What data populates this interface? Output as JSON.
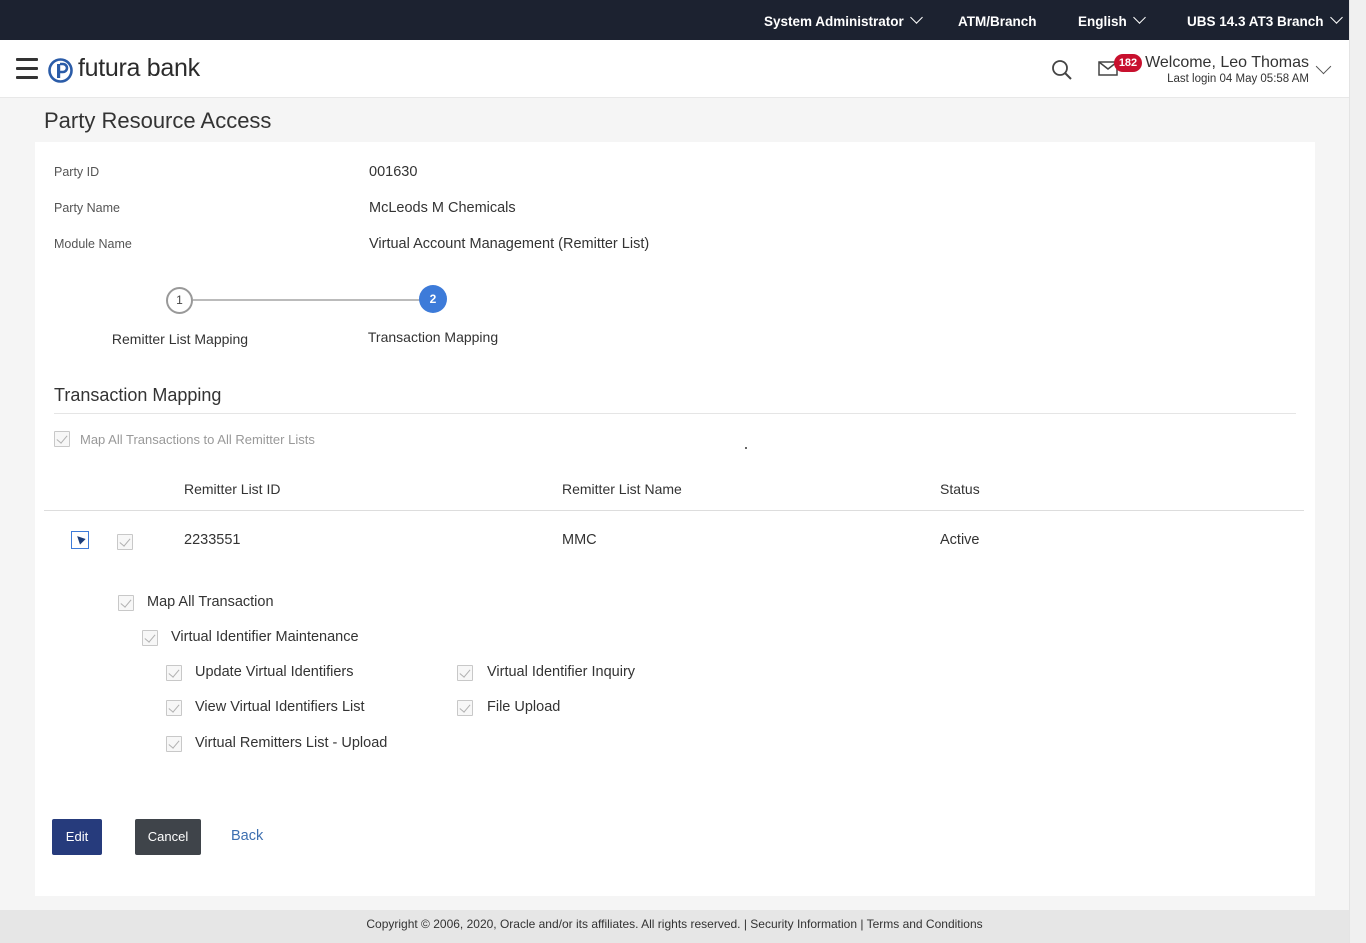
{
  "topbar": {
    "role": "System Administrator",
    "atm_branch": "ATM/Branch",
    "language": "English",
    "branch": "UBS 14.3 AT3 Branch"
  },
  "header": {
    "brand": "futura bank",
    "notification_count": "182",
    "welcome": "Welcome, Leo Thomas",
    "last_login": "Last login 04 May 05:58 AM"
  },
  "page": {
    "title": "Party Resource Access",
    "fields": [
      {
        "label": "Party ID",
        "value": "001630"
      },
      {
        "label": "Party Name",
        "value": "McLeods M Chemicals"
      },
      {
        "label": "Module Name",
        "value": "Virtual Account Management (Remitter List)"
      }
    ],
    "steps": [
      {
        "number": "1",
        "label": "Remitter List Mapping",
        "state": "completed"
      },
      {
        "number": "2",
        "label": "Transaction Mapping",
        "state": "active"
      }
    ],
    "section_title": "Transaction Mapping",
    "map_all_label": "Map All Transactions to All Remitter Lists",
    "dot": ".",
    "table": {
      "headers": [
        "Remitter List ID",
        "Remitter List Name",
        "Status"
      ],
      "rows": [
        {
          "id": "2233551",
          "name": "MMC",
          "status": "Active"
        }
      ]
    },
    "transactions": {
      "map_all": "Map All Transaction",
      "group": "Virtual Identifier Maintenance",
      "items": [
        "Update Virtual Identifiers",
        "Virtual Identifier Inquiry",
        "View Virtual Identifiers List",
        "File Upload",
        "Virtual Remitters List - Upload"
      ]
    },
    "buttons": {
      "edit": "Edit",
      "cancel": "Cancel",
      "back": "Back"
    }
  },
  "footer": {
    "text": "Copyright © 2006, 2020, Oracle and/or its affiliates. All rights reserved. | Security Information | Terms and Conditions"
  },
  "colors": {
    "topbar_bg": "#1c2230",
    "accent": "#3d7bd9",
    "primary_button": "#263b7c",
    "secondary_button": "#3f444a",
    "badge": "#c8102e"
  }
}
